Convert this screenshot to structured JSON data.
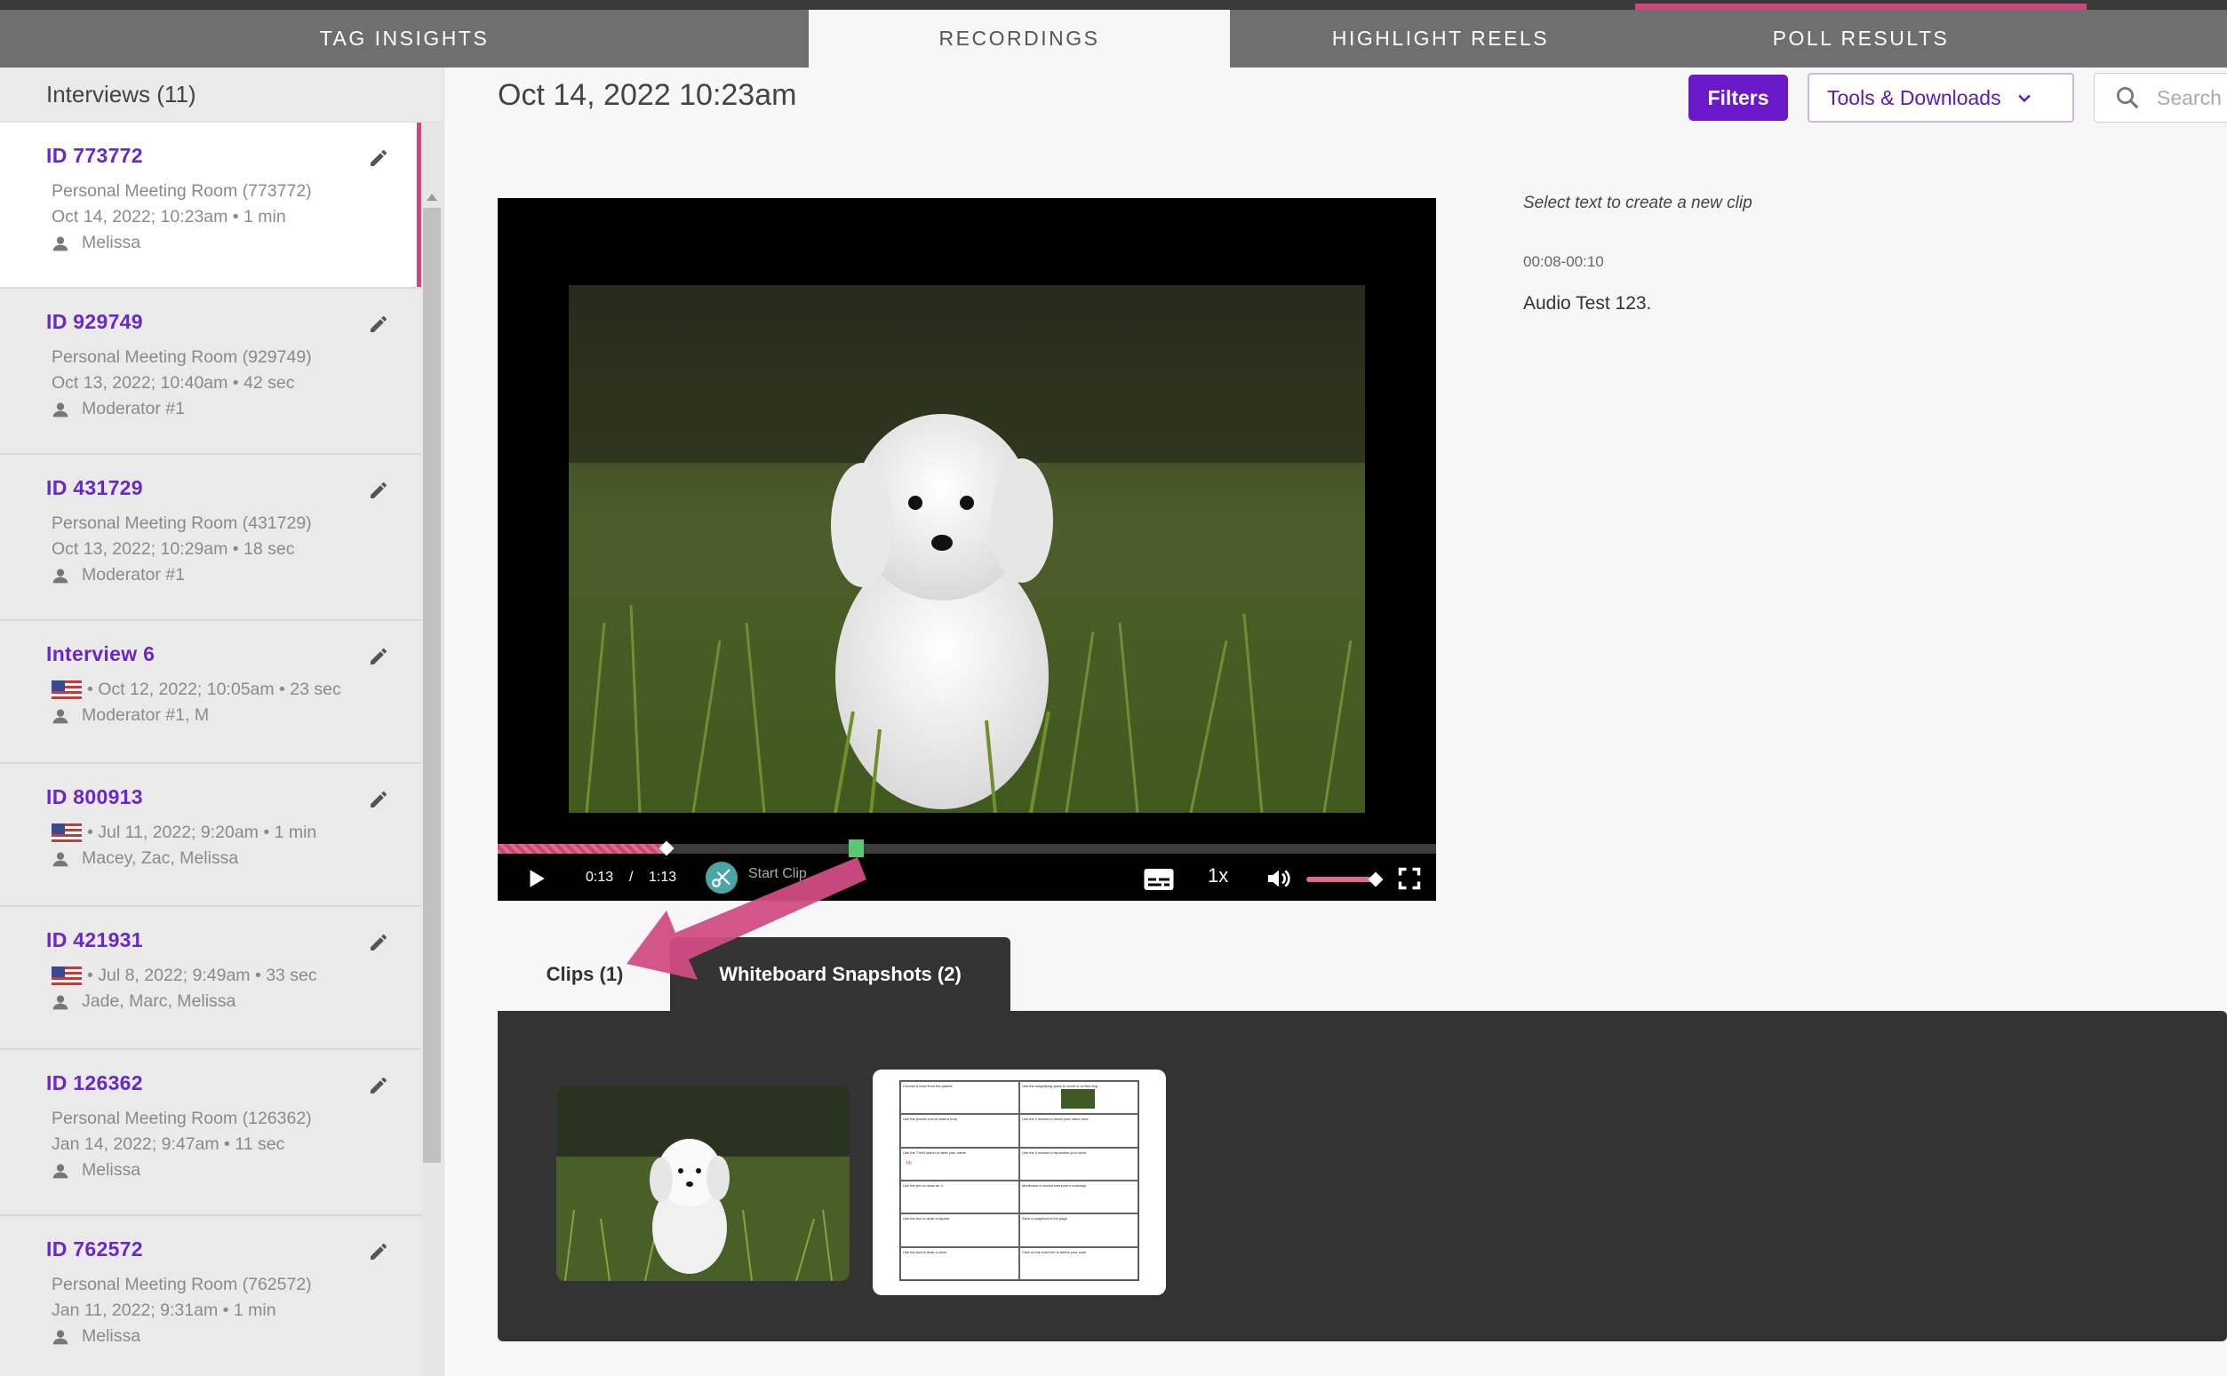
{
  "nav": {
    "tabs": [
      {
        "label": "TAG INSIGHTS"
      },
      {
        "label": "RECORDINGS"
      },
      {
        "label": "HIGHLIGHT REELS"
      },
      {
        "label": "POLL RESULTS"
      }
    ]
  },
  "sidebar": {
    "title": "Interviews (11)",
    "items": [
      {
        "id": "ID 773772",
        "line1": "Personal Meeting Room (773772)",
        "line2": "Oct 14, 2022; 10:23am • 1 min",
        "people": "Melissa"
      },
      {
        "id": "ID 929749",
        "line1": "Personal Meeting Room (929749)",
        "line2": "Oct 13, 2022; 10:40am • 42 sec",
        "people": "Moderator #1"
      },
      {
        "id": "ID 431729",
        "line1": "Personal Meeting Room (431729)",
        "line2": "Oct 13, 2022; 10:29am • 18 sec",
        "people": "Moderator #1"
      },
      {
        "id": "Interview 6",
        "flagline": "• Oct 12, 2022; 10:05am • 23 sec",
        "people": "Moderator #1, M"
      },
      {
        "id": "ID 800913",
        "flagline": "• Jul 11, 2022; 9:20am • 1 min",
        "people": "Macey, Zac, Melissa"
      },
      {
        "id": "ID 421931",
        "flagline": "• Jul 8, 2022; 9:49am • 33 sec",
        "people": "Jade, Marc, Melissa"
      },
      {
        "id": "ID 126362",
        "line1": "Personal Meeting Room (126362)",
        "line2": "Jan 14, 2022; 9:47am • 11 sec",
        "people": "Melissa"
      },
      {
        "id": "ID 762572",
        "line1": "Personal Meeting Room (762572)",
        "line2": "Jan 11, 2022; 9:31am • 1 min",
        "people": "Melissa"
      }
    ]
  },
  "main": {
    "title": "Oct 14, 2022 10:23am",
    "filters_label": "Filters",
    "tools_label": "Tools & Downloads",
    "search_placeholder": "Search"
  },
  "player": {
    "current_time": "0:13",
    "separator": "/",
    "duration": "1:13",
    "start_clip_label": "Start Clip",
    "speed": "1x",
    "progress": 0.18,
    "volume": 0.9
  },
  "transcript": {
    "hint": "Select text to create a new clip",
    "time_range": "00:08-00:10",
    "text": "Audio Test 123."
  },
  "subtabs": {
    "clips_label": "Clips (1)",
    "whiteboard_label": "Whiteboard Snapshots (2)"
  },
  "whiteboard": {
    "cells": [
      "Choose a color from the palette",
      "Use the magnifying glass to zoom in on this dog",
      "Use the pointer tool to draw a loop",
      "Use the 4 arrows to move your name here",
      "Use the T text option to write your name",
      "Use the 4 arrows to reposition your circle",
      "Use the pen to draw an X",
      "Moderator to reveal everyone's markings",
      "Use the tool to draw a square",
      "Save a snapshot of the page",
      "Use the tool to draw a circle",
      "Click on the trash bin to delete your work"
    ],
    "marker": "Hi"
  },
  "colors": {
    "accent": "#6a18c8",
    "highlight": "#d0457f",
    "clip_marker": "#5bc775"
  }
}
